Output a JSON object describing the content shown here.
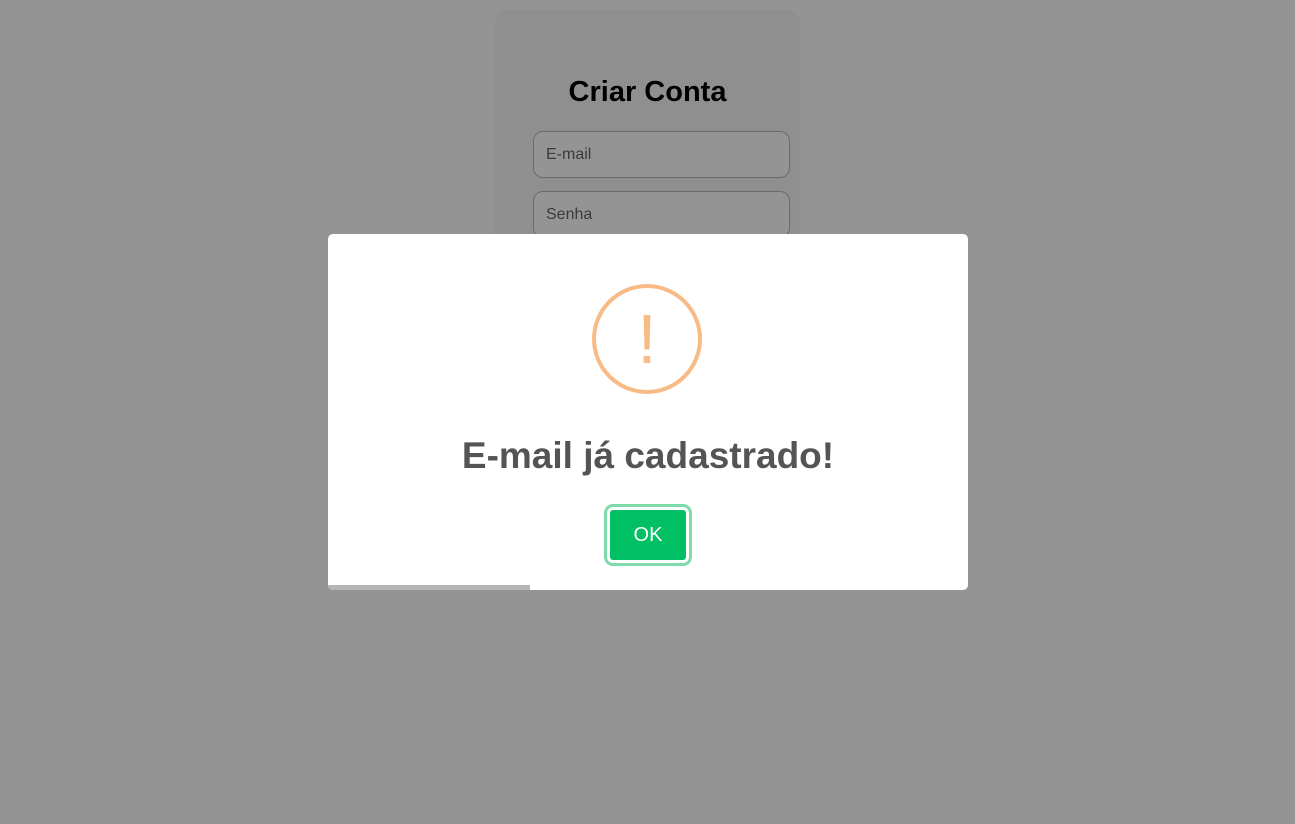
{
  "signup": {
    "title": "Criar Conta",
    "email_placeholder": "E-mail",
    "password_placeholder": "Senha"
  },
  "alert": {
    "icon": "warning-icon",
    "icon_glyph": "!",
    "icon_color": "#f8bb86",
    "title": "E-mail já cadastrado!",
    "confirm_label": "OK",
    "confirm_color": "#00c063",
    "timer_progress": 0.316
  }
}
